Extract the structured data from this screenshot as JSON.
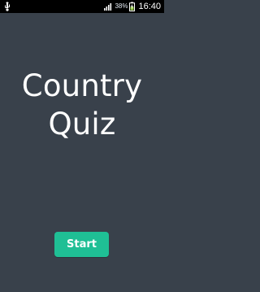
{
  "status_bar": {
    "battery_percent": "38%",
    "time": "16:40",
    "icons": [
      "usb-icon",
      "signal-icon",
      "battery-charging-icon"
    ]
  },
  "app": {
    "title_line_1": "Country",
    "title_line_2": "Quiz",
    "start_label": "Start"
  },
  "colors": {
    "background": "#39414b",
    "status_bar": "#000000",
    "button": "#1fbf95",
    "text": "#ffffff"
  }
}
